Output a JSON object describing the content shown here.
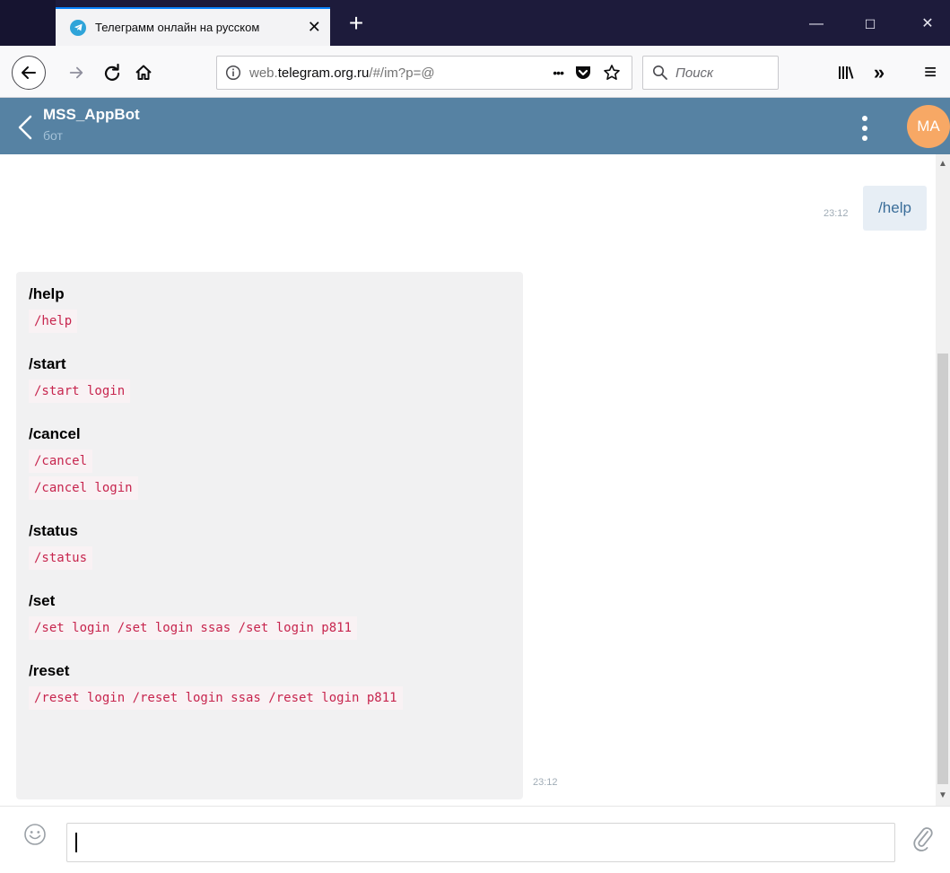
{
  "browser": {
    "tab_title": "Телеграмм онлайн на русском",
    "tab_close": "✕",
    "new_tab": "+",
    "window_controls": {
      "minimize": "—",
      "maximize": "☐",
      "close": "✕"
    },
    "url": {
      "prefix": "web.",
      "host": "telegram.org.ru",
      "path": "/#/im?p=@"
    },
    "url_actions": {
      "more": "•••"
    },
    "search_placeholder": "Поиск",
    "overflow": "»",
    "menu": "≡",
    "icons": [
      "back-arrow-icon",
      "forward-arrow-icon",
      "reload-icon",
      "home-icon",
      "info-icon",
      "pocket-icon",
      "bookmark-star-icon",
      "search-icon",
      "library-icon",
      "overflow-chevrons-icon",
      "hamburger-menu-icon"
    ]
  },
  "chat_header": {
    "name": "MSS_AppBot",
    "status": "бот",
    "avatar_initials": "MA",
    "avatar_color": "#f7a865",
    "header_color": "#5682a3"
  },
  "messages": {
    "outgoing": {
      "text": "/help",
      "time": "23:12"
    },
    "incoming": {
      "time": "23:12",
      "commands": [
        {
          "title": "/help",
          "codes": [
            "/help"
          ]
        },
        {
          "title": "/start",
          "codes": [
            "/start login"
          ]
        },
        {
          "title": "/cancel",
          "codes": [
            "/cancel",
            "/cancel login"
          ]
        },
        {
          "title": "/status",
          "codes": [
            "/status"
          ]
        },
        {
          "title": "/set",
          "codes": [
            "/set login /set login ssas /set login p811"
          ]
        },
        {
          "title": "/reset",
          "codes": [
            "/reset login /reset login ssas /reset login p811"
          ]
        }
      ]
    }
  },
  "composer": {
    "value": "",
    "placeholder": ""
  }
}
